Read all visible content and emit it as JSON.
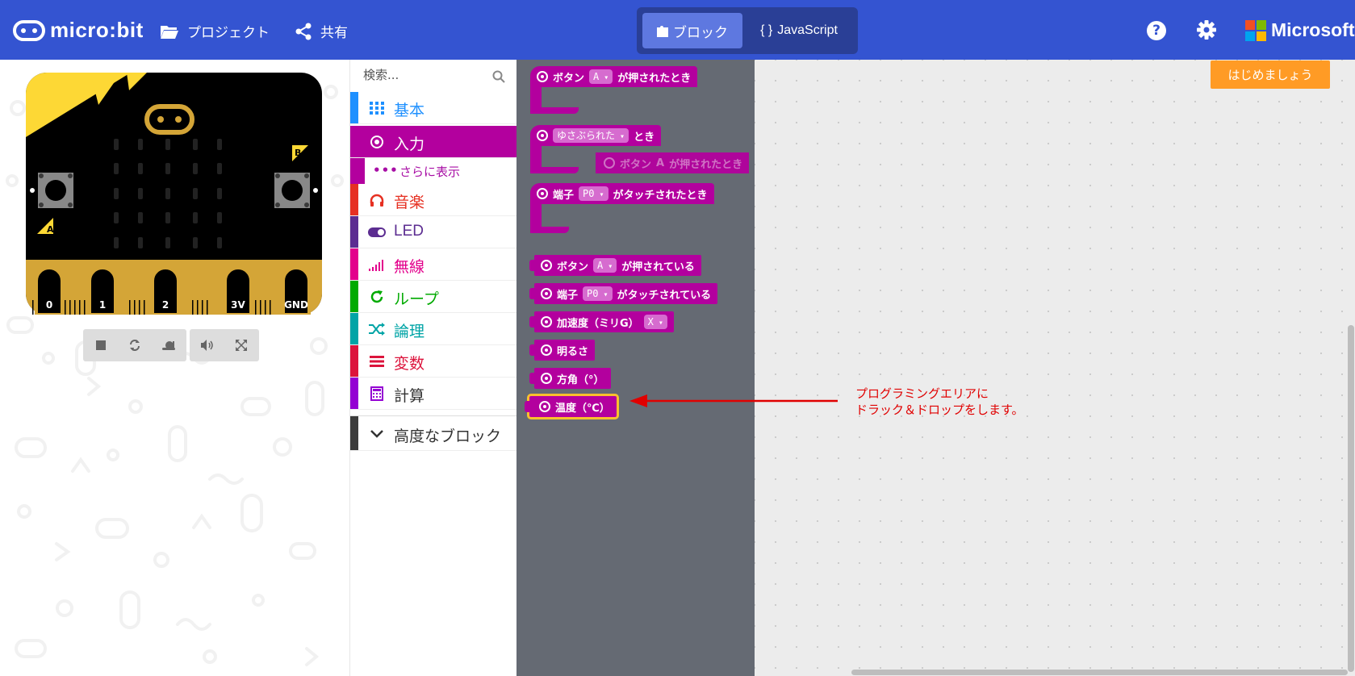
{
  "header": {
    "logo_text": "micro:bit",
    "projects_label": "プロジェクト",
    "share_label": "共有",
    "blocks_tab": "ブロック",
    "js_tab": "JavaScript",
    "js_braces": "{ }",
    "help_glyph": "?",
    "ms_label": "Microsoft",
    "ms_colors": [
      "#F25022",
      "#7FBA00",
      "#00A4EF",
      "#FFB900"
    ]
  },
  "simulator": {
    "pin_labels": [
      "0",
      "1",
      "2",
      "3V",
      "GND"
    ],
    "button_a": "A",
    "button_b": "B",
    "controls": [
      "stop-icon",
      "restart-icon",
      "slowmo-icon",
      "mute-icon",
      "fullscreen-icon"
    ]
  },
  "toolbox": {
    "search_placeholder": "検索...",
    "categories": [
      {
        "label": "基本",
        "color": "#1E90FF",
        "icon": "grid-icon"
      },
      {
        "label": "入力",
        "color": "#B3009E",
        "icon": "target-icon"
      },
      {
        "label": "音楽",
        "color": "#E63022",
        "icon": "headphones-icon"
      },
      {
        "label": "LED",
        "color": "#5C2D91",
        "icon": "toggle-icon"
      },
      {
        "label": "無線",
        "color": "#E3008C",
        "icon": "signal-icon"
      },
      {
        "label": "ループ",
        "color": "#00AA00",
        "icon": "refresh-icon"
      },
      {
        "label": "論理",
        "color": "#00A4A6",
        "icon": "shuffle-icon"
      },
      {
        "label": "変数",
        "color": "#DC143C",
        "icon": "list-icon"
      },
      {
        "label": "計算",
        "color": "#9400D3",
        "icon": "calculator-icon"
      },
      {
        "label": "高度なブロック",
        "color": "#3C3C3C",
        "icon": "chevron-down-icon"
      }
    ],
    "more_label": "さらに表示",
    "more_dots": "•••"
  },
  "flyout": {
    "b1_pre": "ボタン",
    "b1_dd": "A",
    "b1_post": "が押されたとき",
    "b2_dd": "ゆさぶられた",
    "b2_post": "とき",
    "b3_pre": "端子",
    "b3_dd": "P0",
    "b3_post": "がタッチされたとき",
    "b4_pre": "ボタン",
    "b4_dd": "A",
    "b4_post": "が押されている",
    "b5_pre": "端子",
    "b5_dd": "P0",
    "b5_post": "がタッチされている",
    "b6_pre": "加速度（ミリG）",
    "b6_dd": "X",
    "b7": "明るさ",
    "b8": "方角（°）",
    "b9": "温度（℃）",
    "ghost_pre": "ボタン",
    "ghost_dd": "A",
    "ghost_post": "が押されたとき"
  },
  "workspace": {
    "start_label": "はじめましょう",
    "annotation_line1": "プログラミングエリアに",
    "annotation_line2": "ドラック＆ドロップをします。"
  }
}
